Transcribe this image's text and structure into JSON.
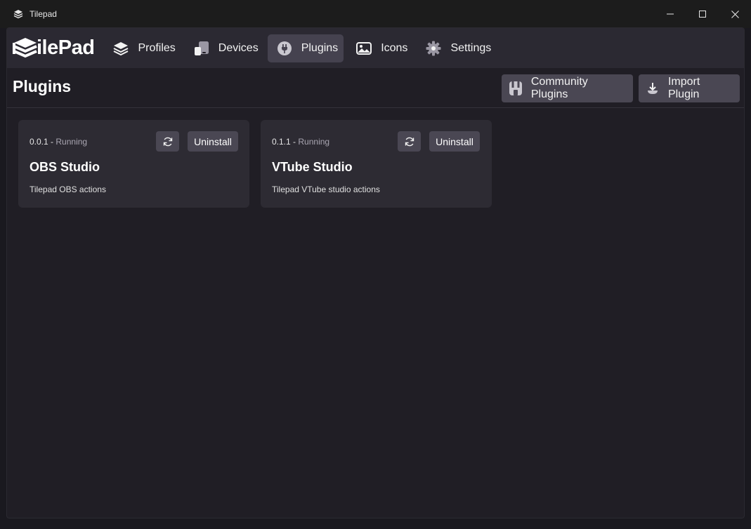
{
  "window": {
    "title": "Tilepad"
  },
  "nav": {
    "logo_text": "ilePad",
    "items": [
      {
        "label": "Profiles",
        "icon": "layers-icon"
      },
      {
        "label": "Devices",
        "icon": "devices-icon"
      },
      {
        "label": "Plugins",
        "icon": "plug-icon",
        "active": true
      },
      {
        "label": "Icons",
        "icon": "image-icon"
      },
      {
        "label": "Settings",
        "icon": "gear-icon"
      }
    ]
  },
  "header": {
    "title": "Plugins",
    "community_label": "Community Plugins",
    "import_label": "Import Plugin"
  },
  "plugins": [
    {
      "version": "0.0.1",
      "separator": " - ",
      "status": "Running",
      "name": "OBS Studio",
      "description": "Tilepad OBS actions",
      "uninstall_label": "Uninstall"
    },
    {
      "version": "0.1.1",
      "separator": " - ",
      "status": "Running",
      "name": "VTube Studio",
      "description": "Tilepad VTube studio actions",
      "uninstall_label": "Uninstall"
    }
  ],
  "colors": {
    "background": "#201e25",
    "navbar": "#2b2932",
    "card": "#2d2b33",
    "button": "#4a4753",
    "active_nav": "#45424f"
  }
}
